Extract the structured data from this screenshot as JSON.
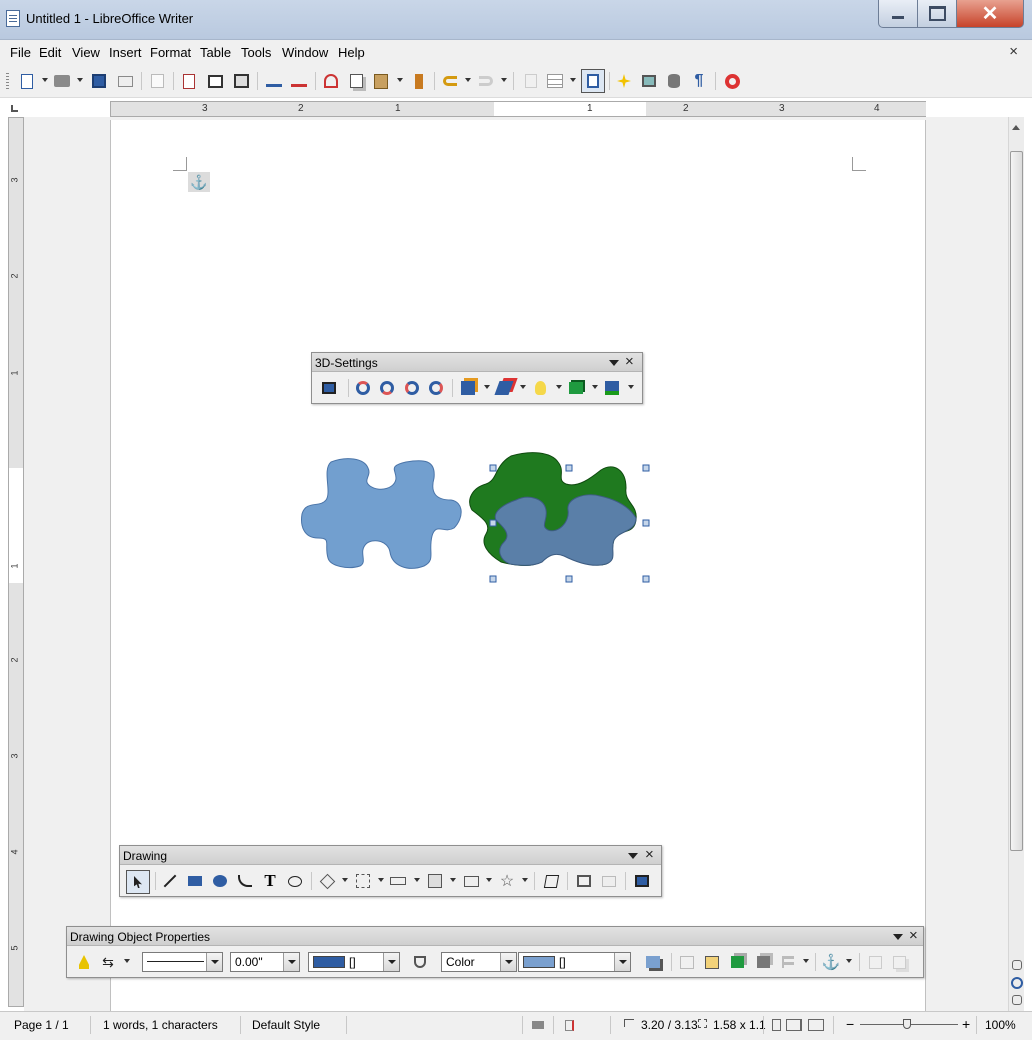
{
  "window": {
    "title": "Untitled 1 - LibreOffice Writer",
    "close_glyph": "✕"
  },
  "menu": {
    "items": [
      "File",
      "Edit",
      "View",
      "Insert",
      "Format",
      "Table",
      "Tools",
      "Window",
      "Help"
    ],
    "doc_close": "×"
  },
  "ruler_h": {
    "labels": [
      "3",
      "2",
      "1",
      "1",
      "2",
      "3",
      "4"
    ]
  },
  "ruler_v": {
    "labels": [
      "3",
      "2",
      "1",
      "1",
      "2",
      "3",
      "4",
      "5"
    ]
  },
  "toolbar_3d": {
    "title": "3D-Settings"
  },
  "toolbar_drawing": {
    "title": "Drawing"
  },
  "toolbar_props": {
    "title": "Drawing Object Properties",
    "line_width": "0.00\"",
    "line_color_value": "[]",
    "area_style": "Color",
    "fill_color_value": "[]",
    "line_swatch_color": "#2f5da3",
    "fill_swatch_color": "#7aa0cf"
  },
  "shapes": {
    "flat_fill": "#729fcf",
    "extrude_side": "#1f7a1f",
    "extrude_face": "#5a7fa8"
  },
  "status": {
    "page": "Page 1 / 1",
    "words": "1 words, 1 characters",
    "style": "Default Style",
    "position": "3.20 / 3.13",
    "size": "1.58 x 1.1",
    "zoom": "100%"
  }
}
